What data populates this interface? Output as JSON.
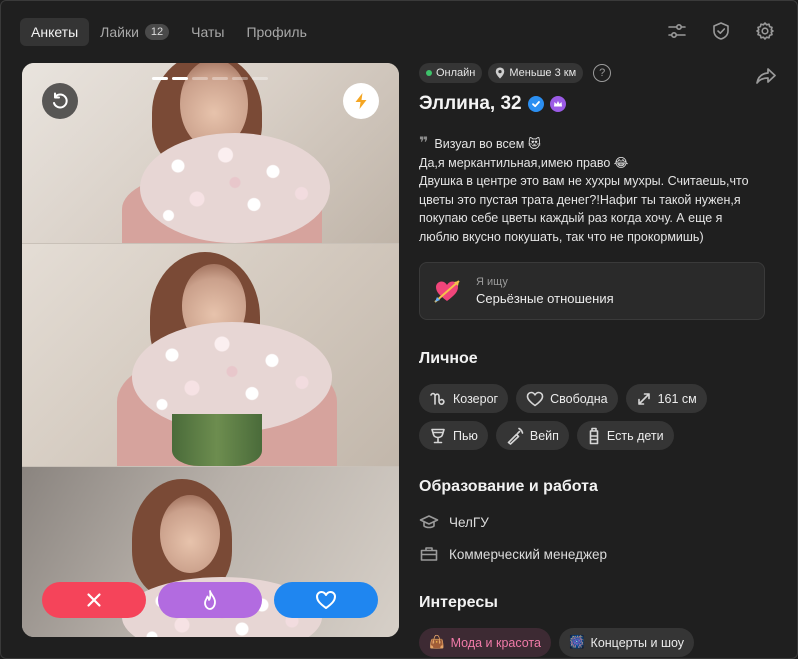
{
  "nav": {
    "tabs": [
      {
        "label": "Анкеты",
        "active": true
      },
      {
        "label": "Лайки",
        "badge": "12"
      },
      {
        "label": "Чаты"
      },
      {
        "label": "Профиль"
      }
    ],
    "icons": [
      "filters-icon",
      "shield-check-icon",
      "settings-gear-icon"
    ]
  },
  "photo": {
    "progress": {
      "current": 2,
      "total": 6
    },
    "actions": [
      "dislike-cross-icon",
      "superlike-fire-icon",
      "like-heart-icon"
    ],
    "colors": {
      "dislike": "#f5445a",
      "superlike": "#b26be0",
      "like": "#1f86f0"
    }
  },
  "profile": {
    "status": "Онлайн",
    "distance": "Меньше 3 км",
    "help": "?",
    "name": "Эллина, 32",
    "bio_quote": "❞",
    "bio": [
      "Визуал во всем 😻",
      "Да,я меркантильная,имею право 😂",
      "Двушка в центре это вам не хухры мухры. Считаешь,что",
      "цветы это пустая трата денег?!Нафиг ты такой нужен,я",
      "покупаю себе цветы каждый раз когда хочу. А еще я",
      "люблю вкусно покушать, так что не прокормишь)"
    ],
    "looking_for": {
      "label": "Я ищу",
      "value": "Серьёзные отношения",
      "emoji": "💘"
    }
  },
  "personal": {
    "title": "Личное",
    "tags": [
      {
        "label": "Козерог",
        "icon": "capricorn-icon"
      },
      {
        "label": "Свободна",
        "icon": "heart-outline-icon"
      },
      {
        "label": "161 см",
        "icon": "height-arrows-icon"
      },
      {
        "label": "Пью",
        "icon": "glass-icon"
      },
      {
        "label": "Вейп",
        "icon": "vape-icon"
      },
      {
        "label": "Есть дети",
        "icon": "baby-bottle-icon"
      }
    ]
  },
  "education": {
    "title": "Образование и работа",
    "items": [
      {
        "label": "ЧелГУ",
        "icon": "graduation-cap-icon"
      },
      {
        "label": "Коммерческий менеджер",
        "icon": "briefcase-icon"
      }
    ]
  },
  "interests": {
    "title": "Интересы",
    "tags": [
      {
        "label": "Мода и красота",
        "emoji": "👜",
        "color": "#f07aa8"
      },
      {
        "label": "Концерты и шоу",
        "emoji": "🎆"
      }
    ]
  }
}
